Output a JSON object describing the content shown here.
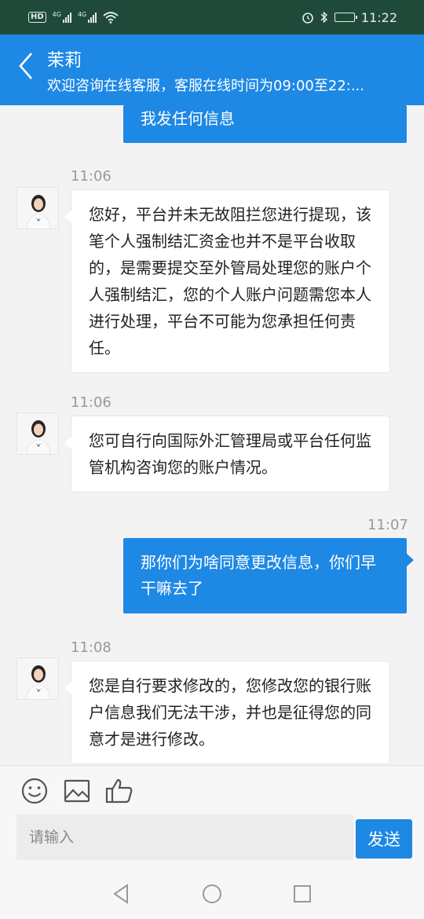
{
  "status_bar": {
    "hd_label": "HD",
    "net1": "4G",
    "net2": "4G",
    "time": "11:22"
  },
  "header": {
    "title": "茉莉",
    "subtitle": "欢迎咨询在线客服，客服在线时间为09:00至22:..."
  },
  "messages": [
    {
      "side": "right",
      "text": "我发任何信息"
    },
    {
      "side": "left",
      "time": "11:06",
      "text": "您好，平台并未无故阻拦您进行提现，该笔个人强制结汇资金也并不是平台收取的，是需要提交至外管局处理您的账户个人强制结汇，您的个人账户问题需您本人进行处理，平台不可能为您承担任何责任。"
    },
    {
      "side": "left",
      "time": "11:06",
      "text": "您可自行向国际外汇管理局或平台任何监管机构咨询您的账户情况。"
    },
    {
      "side": "right",
      "time": "11:07",
      "text": "那你们为啥同意更改信息，你们早干嘛去了"
    },
    {
      "side": "left",
      "time": "11:08",
      "text": "您是自行要求修改的，您修改您的银行账户信息我们无法干涉，并也是征得您的同意才是进行修改。"
    }
  ],
  "input": {
    "placeholder": "请输入",
    "send_label": "发送"
  },
  "icons": {
    "emoji": "emoji-icon",
    "image": "image-icon",
    "like": "thumbs-up-icon"
  },
  "colors": {
    "primary": "#1e88e5",
    "status_bar": "#1f4a3a"
  }
}
